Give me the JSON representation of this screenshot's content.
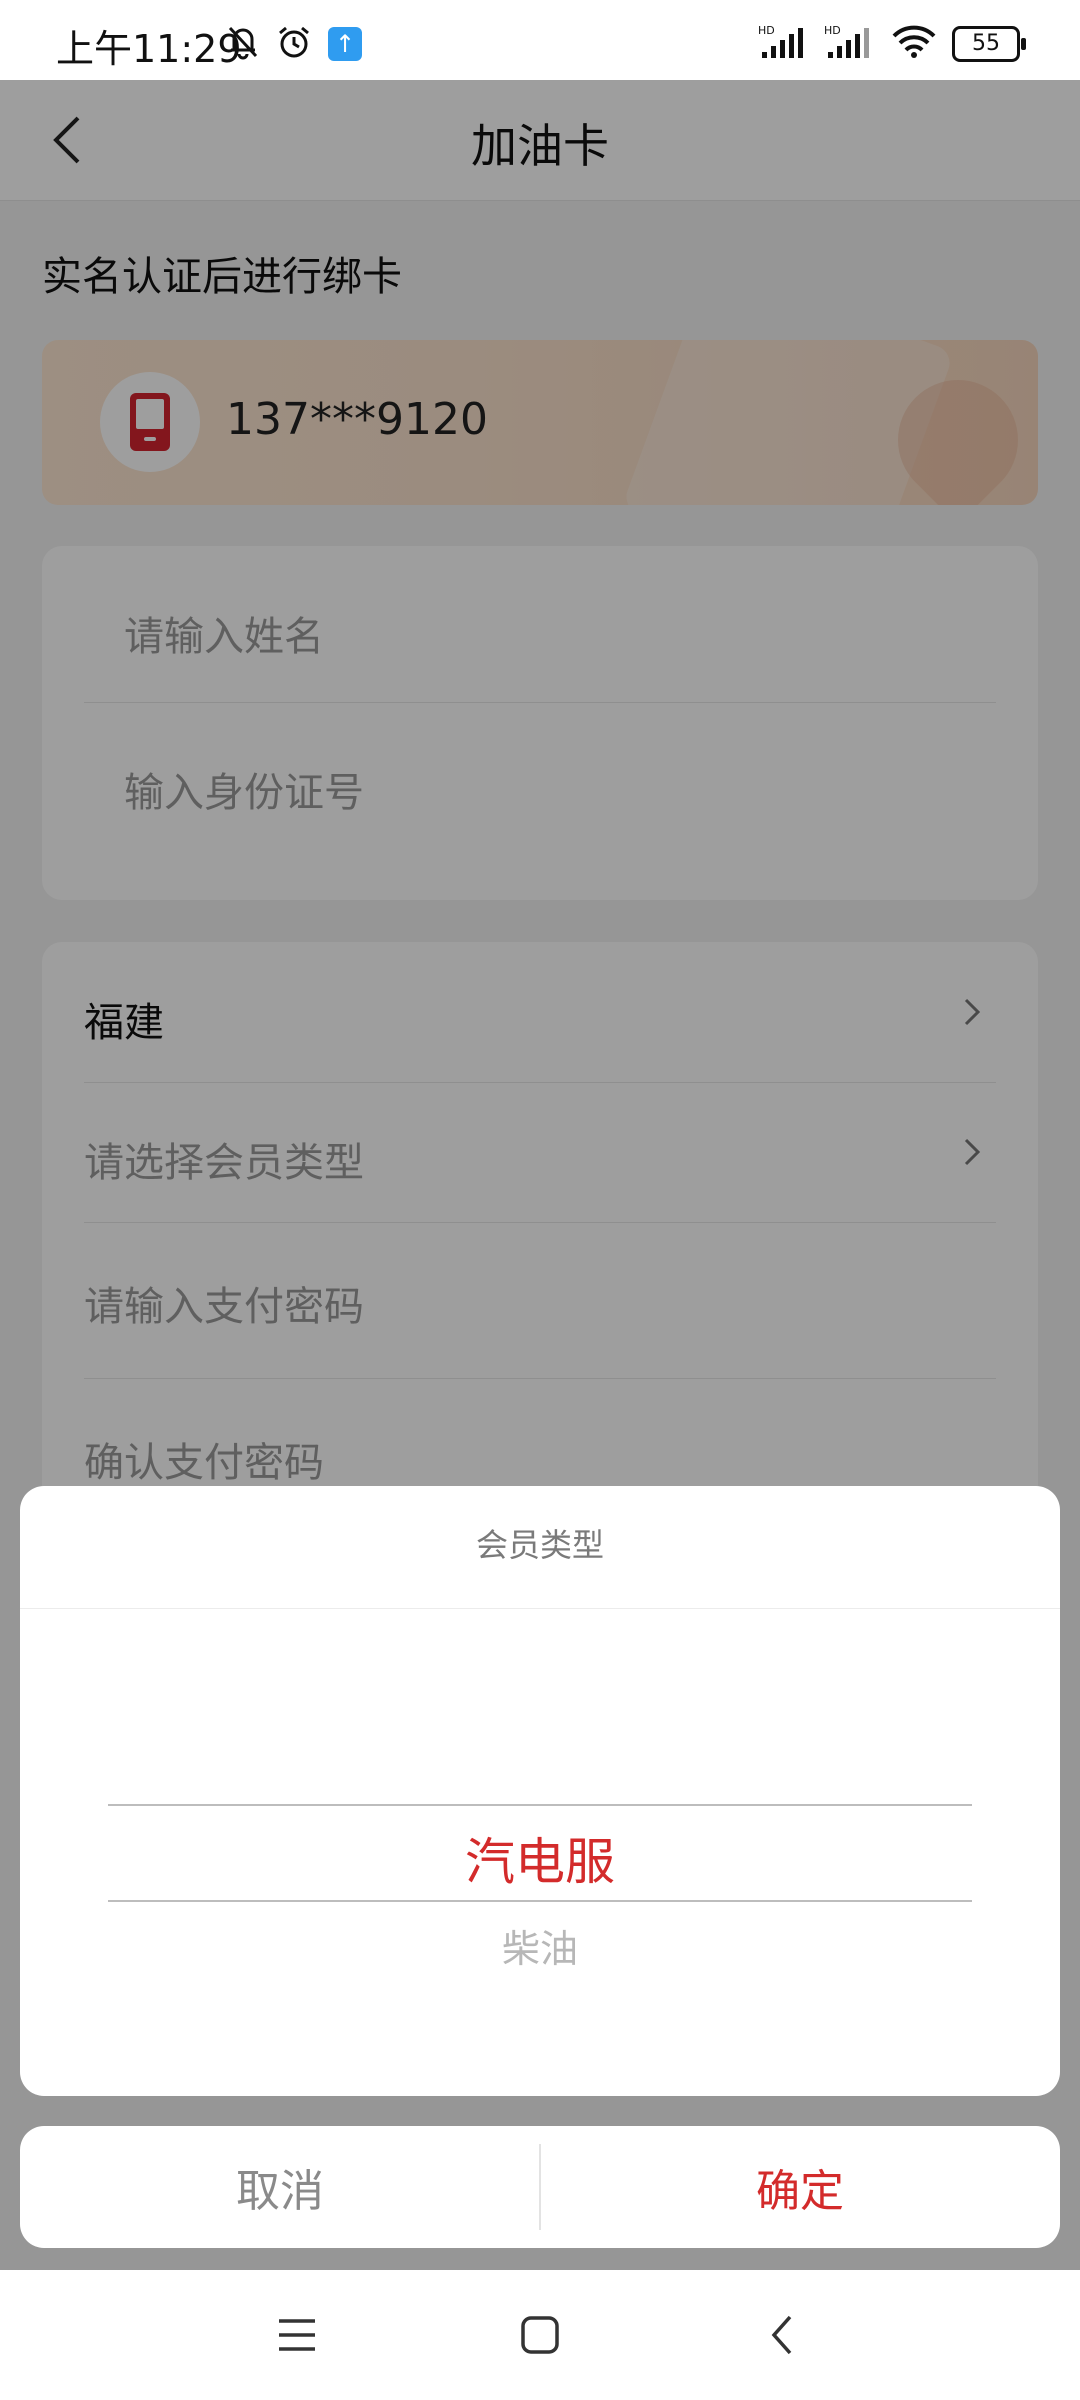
{
  "status_bar": {
    "time": "上午11:29",
    "battery": "55",
    "left_icons": [
      "bell-off-icon",
      "alarm-icon",
      "app-notification-icon"
    ],
    "right_icons": [
      "hd-signal-1-icon",
      "hd-signal-2-icon",
      "wifi-icon",
      "battery-icon"
    ]
  },
  "header": {
    "title": "加油卡",
    "back_icon": "chevron-left-icon"
  },
  "section": {
    "heading": "实名认证后进行绑卡"
  },
  "phone_card": {
    "number": "137***9120"
  },
  "identity_form": {
    "name_placeholder": "请输入姓名",
    "id_placeholder": "输入身份证号"
  },
  "member_form": {
    "province": "福建",
    "member_type_placeholder": "请选择会员类型",
    "pay_password_placeholder": "请输入支付密码",
    "confirm_password_placeholder": "确认支付密码"
  },
  "picker": {
    "title": "会员类型",
    "selected": "汽电服",
    "next": "柴油"
  },
  "actions": {
    "cancel": "取消",
    "confirm": "确定"
  },
  "colors": {
    "accent": "#d32b2b",
    "card_gradient_start": "#fde7d2",
    "card_gradient_end": "#f6d6bd"
  }
}
